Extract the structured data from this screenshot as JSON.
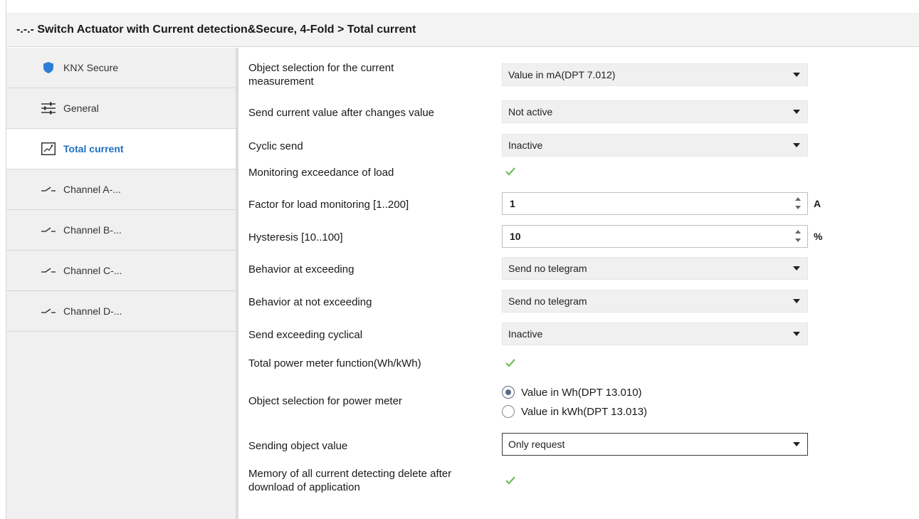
{
  "title": "-.-.- Switch Actuator with Current detection&Secure, 4-Fold > Total current",
  "sidebar": {
    "items": [
      {
        "label": "KNX Secure",
        "icon": "shield-icon"
      },
      {
        "label": "General",
        "icon": "sliders-icon"
      },
      {
        "label": "Total current",
        "icon": "chart-icon",
        "active": true
      },
      {
        "label": "Channel A-...",
        "icon": "switch-icon"
      },
      {
        "label": "Channel B-...",
        "icon": "switch-icon"
      },
      {
        "label": "Channel C-...",
        "icon": "switch-icon"
      },
      {
        "label": "Channel D-...",
        "icon": "switch-icon"
      }
    ]
  },
  "params": {
    "object_selection": {
      "label": "Object selection for the current measurement",
      "value": "Value in mA(DPT 7.012)"
    },
    "send_after_change": {
      "label": "Send current value after changes value",
      "value": "Not active"
    },
    "cyclic_send": {
      "label": "Cyclic send",
      "value": "Inactive"
    },
    "monitoring": {
      "label": "Monitoring exceedance of load",
      "checked": true
    },
    "factor": {
      "label": "Factor for load monitoring [1..200]",
      "value": "1",
      "unit": "A"
    },
    "hysteresis": {
      "label": "Hysteresis [10..100]",
      "value": "10",
      "unit": "%"
    },
    "behavior_exceeding": {
      "label": "Behavior at exceeding",
      "value": "Send no telegram"
    },
    "behavior_not_exceeding": {
      "label": "Behavior at not exceeding",
      "value": "Send no telegram"
    },
    "send_exceeding_cyclical": {
      "label": "Send exceeding cyclical",
      "value": "Inactive"
    },
    "power_meter_function": {
      "label": "Total power meter function(Wh/kWh)",
      "checked": true
    },
    "power_meter_object": {
      "label": "Object selection for power meter",
      "options": [
        "Value in Wh(DPT 13.010)",
        "Value in kWh(DPT 13.013)"
      ],
      "selected": "Value in Wh(DPT 13.010)"
    },
    "sending_object_value": {
      "label": "Sending object value",
      "value": "Only request"
    },
    "memory_delete": {
      "label": "Memory of all current detecting delete after download of application",
      "checked": true
    }
  },
  "colors": {
    "accent": "#1f6fbf",
    "check": "#6cbf5a",
    "shield": "#2b7fd6"
  }
}
